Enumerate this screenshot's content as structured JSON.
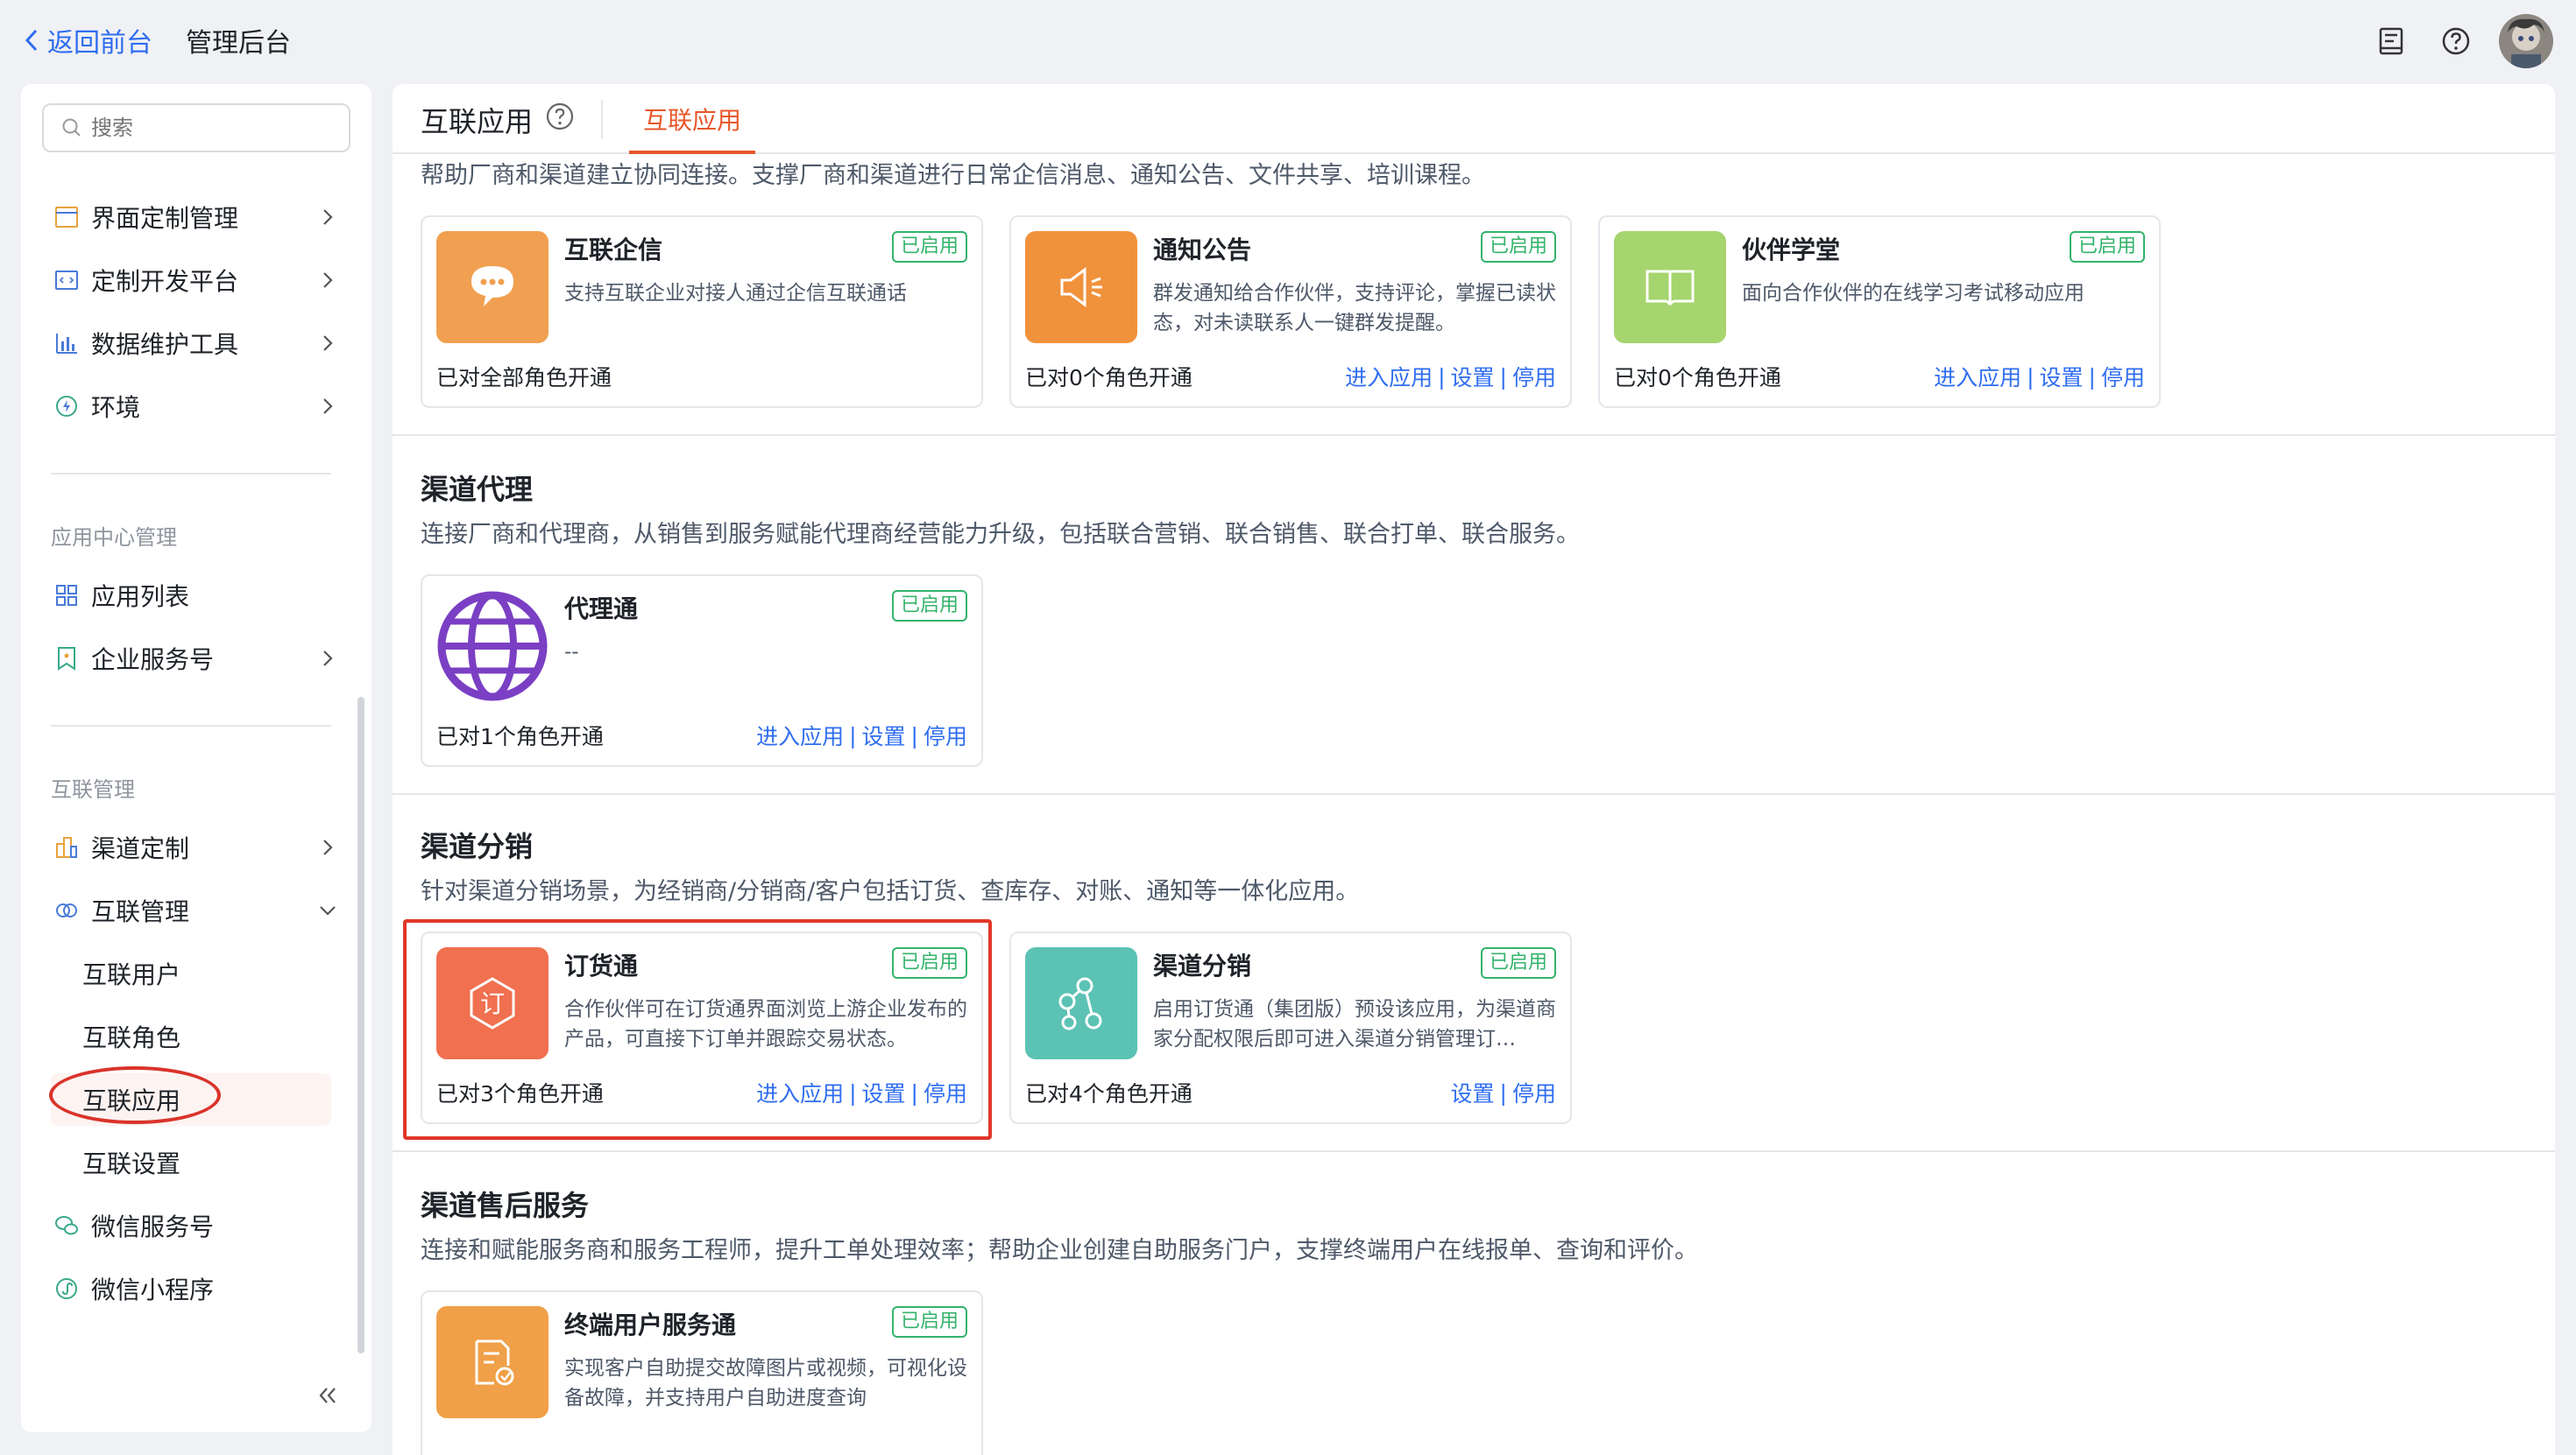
{
  "topbar": {
    "back_label": "返回前台",
    "title": "管理后台",
    "icons": [
      "notebook-icon",
      "help-icon",
      "avatar"
    ]
  },
  "sidebar": {
    "search_placeholder": "搜索",
    "items_top": [
      {
        "label": "界面定制管理",
        "icon": "layout-icon"
      },
      {
        "label": "定制开发平台",
        "icon": "code-icon"
      },
      {
        "label": "数据维护工具",
        "icon": "chart-icon"
      },
      {
        "label": "环境",
        "icon": "environment-icon"
      }
    ],
    "group_app_center": "应用中心管理",
    "items_app_center": [
      {
        "label": "应用列表",
        "icon": "grid-icon"
      },
      {
        "label": "企业服务号",
        "icon": "bookmark-icon"
      }
    ],
    "group_interconnect": "互联管理",
    "items_interconnect": [
      {
        "label": "渠道定制",
        "icon": "building-icon"
      },
      {
        "label": "互联管理",
        "icon": "link-rings-icon"
      }
    ],
    "sub_items": [
      "互联用户",
      "互联角色",
      "互联应用",
      "互联设置"
    ],
    "active_sub": "互联应用",
    "items_bottom": [
      {
        "label": "微信服务号",
        "icon": "wechat-icon"
      },
      {
        "label": "微信小程序",
        "icon": "mini-program-icon"
      }
    ]
  },
  "main": {
    "title": "互联应用",
    "tab": "互联应用",
    "sections": [
      {
        "title": "",
        "desc": "帮助厂商和渠道建立协同连接。支撑厂商和渠道进行日常企信消息、通知公告、文件共享、培训课程。",
        "cards": [
          {
            "name": "互联企信",
            "badge": "已启用",
            "desc": "支持互联企业对接人通过企信互联通话",
            "status": "已对全部角色开通",
            "actions": [],
            "icon": "chat-bubble-icon",
            "color": "#f0a050"
          },
          {
            "name": "通知公告",
            "badge": "已启用",
            "desc": "群发通知给合作伙伴，支持评论，掌握已读状态，对未读联系人一键群发提醒。",
            "status": "已对0个角色开通",
            "actions": [
              "进入应用",
              "设置",
              "停用"
            ],
            "icon": "megaphone-icon",
            "color": "#f0923c"
          },
          {
            "name": "伙伴学堂",
            "badge": "已启用",
            "desc": "面向合作伙伴的在线学习考试移动应用",
            "status": "已对0个角色开通",
            "actions": [
              "进入应用",
              "设置",
              "停用"
            ],
            "icon": "book-icon",
            "color": "#a6d46e"
          }
        ]
      },
      {
        "title": "渠道代理",
        "desc": "连接厂商和代理商，从销售到服务赋能代理商经营能力升级，包括联合营销、联合销售、联合打单、联合服务。",
        "cards": [
          {
            "name": "代理通",
            "badge": "已启用",
            "desc": "--",
            "status": "已对1个角色开通",
            "actions": [
              "进入应用",
              "设置",
              "停用"
            ],
            "icon": "globe-icon",
            "color": "#7b3fc4"
          }
        ]
      },
      {
        "title": "渠道分销",
        "desc": "针对渠道分销场景，为经销商/分销商/客户包括订货、查库存、对账、通知等一体化应用。",
        "cards": [
          {
            "name": "订货通",
            "badge": "已启用",
            "desc": "合作伙伴可在订货通界面浏览上游企业发布的产品，可直接下订单并跟踪交易状态。",
            "status": "已对3个角色开通",
            "actions": [
              "进入应用",
              "设置",
              "停用"
            ],
            "icon": "order-icon",
            "color": "#f07050"
          },
          {
            "name": "渠道分销",
            "badge": "已启用",
            "desc": "启用订货通（集团版）预设该应用，为渠道商家分配权限后即可进入渠道分销管理订…",
            "status": "已对4个角色开通",
            "actions": [
              "设置",
              "停用"
            ],
            "icon": "network-icon",
            "color": "#5cc2b4"
          }
        ]
      },
      {
        "title": "渠道售后服务",
        "desc": "连接和赋能服务商和服务工程师，提升工单处理效率；帮助企业创建自助服务门户，支撑终端用户在线报单、查询和评价。",
        "cards": [
          {
            "name": "终端用户服务通",
            "badge": "已启用",
            "desc": "实现客户自助提交故障图片或视频，可视化设备故障，并支持用户自助进度查询",
            "status": "",
            "actions": [],
            "icon": "service-form-icon",
            "color": "#f0a048"
          }
        ]
      }
    ]
  }
}
